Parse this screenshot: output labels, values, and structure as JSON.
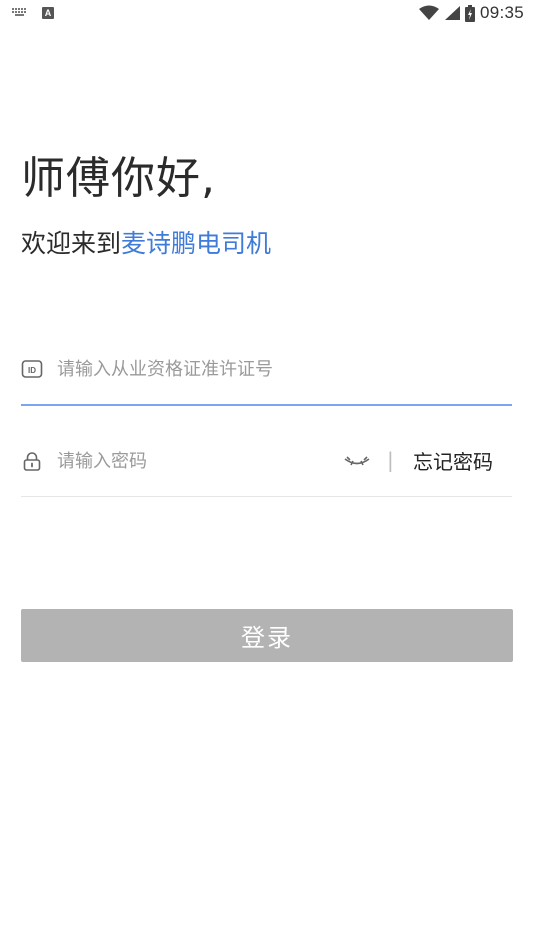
{
  "status_bar": {
    "time": "09:35",
    "icons": [
      "keyboard-icon",
      "a-app-icon",
      "wifi-icon",
      "signal-icon",
      "battery-icon"
    ]
  },
  "header": {
    "greeting": "师傅你好,",
    "welcome_prefix": "欢迎来到",
    "brand": "麦诗鹏电司机"
  },
  "form": {
    "id_placeholder": "请输入从业资格证准许证号",
    "password_placeholder": "请输入密码",
    "divider": "|",
    "forgot_password": "忘记密码",
    "login_label": "登录"
  },
  "colors": {
    "brand": "#3f7bd8",
    "active_underline": "#7ba5f0",
    "button_disabled": "#b3b3b3"
  }
}
